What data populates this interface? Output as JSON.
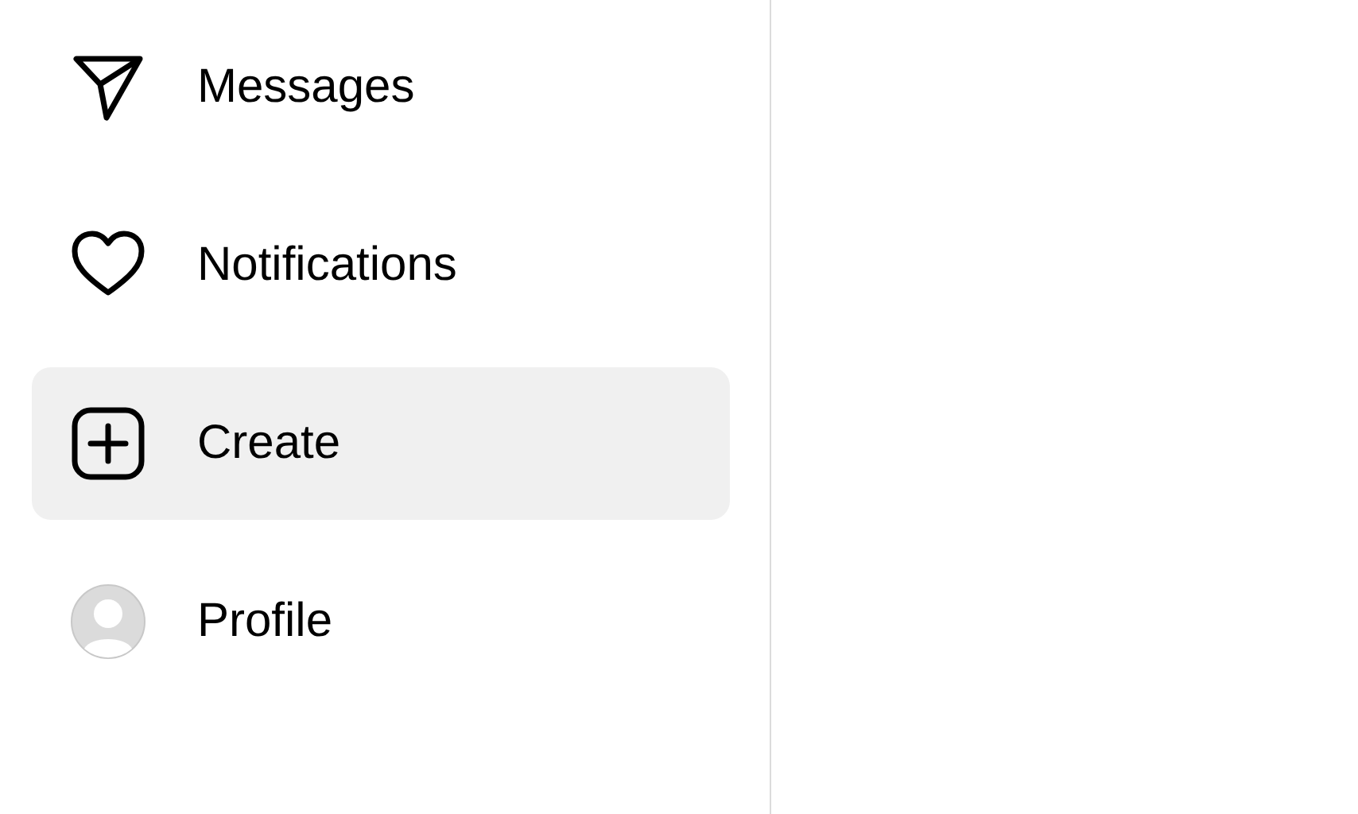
{
  "sidebar": {
    "items": [
      {
        "kind": "send",
        "label": "Messages",
        "selected": false
      },
      {
        "kind": "heart",
        "label": "Notifications",
        "selected": false
      },
      {
        "kind": "create",
        "label": "Create",
        "selected": true
      },
      {
        "kind": "avatar",
        "label": "Profile",
        "selected": false
      }
    ]
  }
}
